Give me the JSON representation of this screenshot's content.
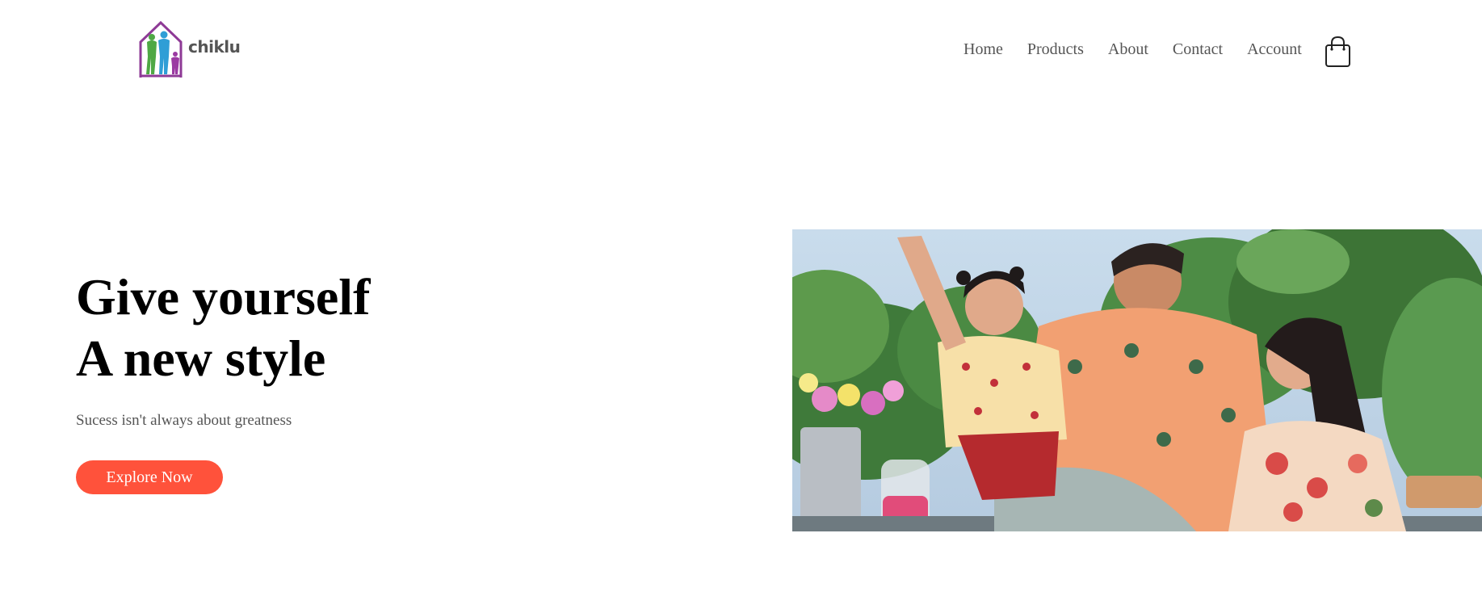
{
  "brand": {
    "name": "chiklu",
    "logo_icon": "family-house-icon",
    "colors": {
      "house": "#8e3a96",
      "figure_green": "#4fa845",
      "figure_blue": "#2f9ed6",
      "figure_purple": "#9b3aa2"
    }
  },
  "nav": {
    "items": [
      {
        "label": "Home"
      },
      {
        "label": "Products"
      },
      {
        "label": "About"
      },
      {
        "label": "Contact"
      },
      {
        "label": "Account"
      }
    ],
    "cart_icon": "shopping-bag-icon"
  },
  "hero": {
    "title_line1": "Give yourself",
    "title_line2": "A new style",
    "subtitle": "Sucess isn't always about greatness",
    "cta_label": "Explore Now",
    "image_icon": "family-photo"
  },
  "colors": {
    "accent": "#ff523b",
    "text_muted": "#555555",
    "text_dark": "#000000"
  }
}
